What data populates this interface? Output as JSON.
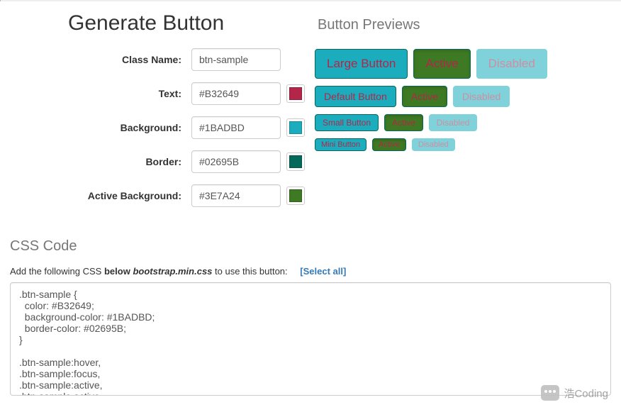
{
  "header": {
    "title": "Generate Button",
    "previews_title": "Button Previews"
  },
  "form": {
    "class_name": {
      "label": "Class Name:",
      "value": "btn-sample"
    },
    "text": {
      "label": "Text:",
      "value": "#B32649"
    },
    "background": {
      "label": "Background:",
      "value": "#1BADBD"
    },
    "border": {
      "label": "Border:",
      "value": "#02695B"
    },
    "active_bg": {
      "label": "Active Background:",
      "value": "#3E7A24"
    }
  },
  "swatches": {
    "text": "#B32649",
    "background": "#1BADBD",
    "border": "#02695B",
    "active_bg": "#3E7A24"
  },
  "previews": {
    "rows": [
      {
        "size": "large",
        "normal": "Large Button",
        "active": "Active",
        "disabled": "Disabled"
      },
      {
        "size": "default",
        "normal": "Default Button",
        "active": "Active",
        "disabled": "Disabled"
      },
      {
        "size": "small",
        "normal": "Small Button",
        "active": "Active",
        "disabled": "Disabled"
      },
      {
        "size": "mini",
        "normal": "Mini Button",
        "active": "Active",
        "disabled": "Disabled"
      }
    ]
  },
  "css_section": {
    "heading": "CSS Code",
    "instruction_prefix": "Add the following CSS ",
    "instruction_bold": "below",
    "instruction_italic": "bootstrap.min.css",
    "instruction_suffix": " to use this button:",
    "select_all": "[Select all]",
    "code": ".btn-sample {\n  color: #B32649;\n  background-color: #1BADBD;\n  border-color: #02695B;\n}\n\n.btn-sample:hover,\n.btn-sample:focus,\n.btn-sample:active,\n.btn-sample.active,"
  },
  "watermark": {
    "text": "浩Coding"
  }
}
